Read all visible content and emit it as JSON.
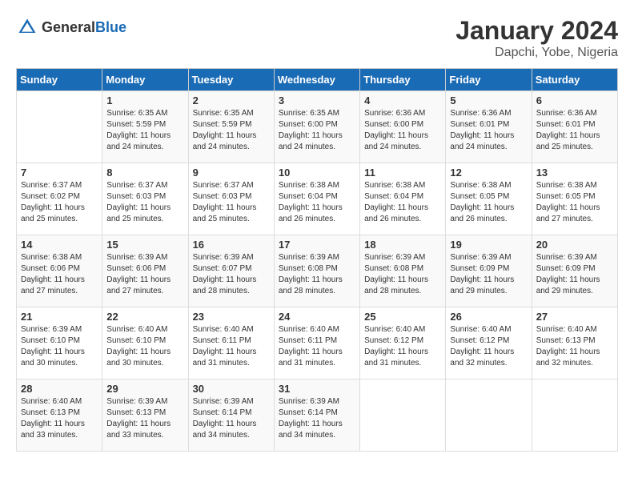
{
  "logo": {
    "general": "General",
    "blue": "Blue"
  },
  "title": "January 2024",
  "location": "Dapchi, Yobe, Nigeria",
  "headers": [
    "Sunday",
    "Monday",
    "Tuesday",
    "Wednesday",
    "Thursday",
    "Friday",
    "Saturday"
  ],
  "weeks": [
    [
      {
        "day": "",
        "sunrise": "",
        "sunset": "",
        "daylight": ""
      },
      {
        "day": "1",
        "sunrise": "Sunrise: 6:35 AM",
        "sunset": "Sunset: 5:59 PM",
        "daylight": "Daylight: 11 hours and 24 minutes."
      },
      {
        "day": "2",
        "sunrise": "Sunrise: 6:35 AM",
        "sunset": "Sunset: 5:59 PM",
        "daylight": "Daylight: 11 hours and 24 minutes."
      },
      {
        "day": "3",
        "sunrise": "Sunrise: 6:35 AM",
        "sunset": "Sunset: 6:00 PM",
        "daylight": "Daylight: 11 hours and 24 minutes."
      },
      {
        "day": "4",
        "sunrise": "Sunrise: 6:36 AM",
        "sunset": "Sunset: 6:00 PM",
        "daylight": "Daylight: 11 hours and 24 minutes."
      },
      {
        "day": "5",
        "sunrise": "Sunrise: 6:36 AM",
        "sunset": "Sunset: 6:01 PM",
        "daylight": "Daylight: 11 hours and 24 minutes."
      },
      {
        "day": "6",
        "sunrise": "Sunrise: 6:36 AM",
        "sunset": "Sunset: 6:01 PM",
        "daylight": "Daylight: 11 hours and 25 minutes."
      }
    ],
    [
      {
        "day": "7",
        "sunrise": "Sunrise: 6:37 AM",
        "sunset": "Sunset: 6:02 PM",
        "daylight": "Daylight: 11 hours and 25 minutes."
      },
      {
        "day": "8",
        "sunrise": "Sunrise: 6:37 AM",
        "sunset": "Sunset: 6:03 PM",
        "daylight": "Daylight: 11 hours and 25 minutes."
      },
      {
        "day": "9",
        "sunrise": "Sunrise: 6:37 AM",
        "sunset": "Sunset: 6:03 PM",
        "daylight": "Daylight: 11 hours and 25 minutes."
      },
      {
        "day": "10",
        "sunrise": "Sunrise: 6:38 AM",
        "sunset": "Sunset: 6:04 PM",
        "daylight": "Daylight: 11 hours and 26 minutes."
      },
      {
        "day": "11",
        "sunrise": "Sunrise: 6:38 AM",
        "sunset": "Sunset: 6:04 PM",
        "daylight": "Daylight: 11 hours and 26 minutes."
      },
      {
        "day": "12",
        "sunrise": "Sunrise: 6:38 AM",
        "sunset": "Sunset: 6:05 PM",
        "daylight": "Daylight: 11 hours and 26 minutes."
      },
      {
        "day": "13",
        "sunrise": "Sunrise: 6:38 AM",
        "sunset": "Sunset: 6:05 PM",
        "daylight": "Daylight: 11 hours and 27 minutes."
      }
    ],
    [
      {
        "day": "14",
        "sunrise": "Sunrise: 6:38 AM",
        "sunset": "Sunset: 6:06 PM",
        "daylight": "Daylight: 11 hours and 27 minutes."
      },
      {
        "day": "15",
        "sunrise": "Sunrise: 6:39 AM",
        "sunset": "Sunset: 6:06 PM",
        "daylight": "Daylight: 11 hours and 27 minutes."
      },
      {
        "day": "16",
        "sunrise": "Sunrise: 6:39 AM",
        "sunset": "Sunset: 6:07 PM",
        "daylight": "Daylight: 11 hours and 28 minutes."
      },
      {
        "day": "17",
        "sunrise": "Sunrise: 6:39 AM",
        "sunset": "Sunset: 6:08 PM",
        "daylight": "Daylight: 11 hours and 28 minutes."
      },
      {
        "day": "18",
        "sunrise": "Sunrise: 6:39 AM",
        "sunset": "Sunset: 6:08 PM",
        "daylight": "Daylight: 11 hours and 28 minutes."
      },
      {
        "day": "19",
        "sunrise": "Sunrise: 6:39 AM",
        "sunset": "Sunset: 6:09 PM",
        "daylight": "Daylight: 11 hours and 29 minutes."
      },
      {
        "day": "20",
        "sunrise": "Sunrise: 6:39 AM",
        "sunset": "Sunset: 6:09 PM",
        "daylight": "Daylight: 11 hours and 29 minutes."
      }
    ],
    [
      {
        "day": "21",
        "sunrise": "Sunrise: 6:39 AM",
        "sunset": "Sunset: 6:10 PM",
        "daylight": "Daylight: 11 hours and 30 minutes."
      },
      {
        "day": "22",
        "sunrise": "Sunrise: 6:40 AM",
        "sunset": "Sunset: 6:10 PM",
        "daylight": "Daylight: 11 hours and 30 minutes."
      },
      {
        "day": "23",
        "sunrise": "Sunrise: 6:40 AM",
        "sunset": "Sunset: 6:11 PM",
        "daylight": "Daylight: 11 hours and 31 minutes."
      },
      {
        "day": "24",
        "sunrise": "Sunrise: 6:40 AM",
        "sunset": "Sunset: 6:11 PM",
        "daylight": "Daylight: 11 hours and 31 minutes."
      },
      {
        "day": "25",
        "sunrise": "Sunrise: 6:40 AM",
        "sunset": "Sunset: 6:12 PM",
        "daylight": "Daylight: 11 hours and 31 minutes."
      },
      {
        "day": "26",
        "sunrise": "Sunrise: 6:40 AM",
        "sunset": "Sunset: 6:12 PM",
        "daylight": "Daylight: 11 hours and 32 minutes."
      },
      {
        "day": "27",
        "sunrise": "Sunrise: 6:40 AM",
        "sunset": "Sunset: 6:13 PM",
        "daylight": "Daylight: 11 hours and 32 minutes."
      }
    ],
    [
      {
        "day": "28",
        "sunrise": "Sunrise: 6:40 AM",
        "sunset": "Sunset: 6:13 PM",
        "daylight": "Daylight: 11 hours and 33 minutes."
      },
      {
        "day": "29",
        "sunrise": "Sunrise: 6:39 AM",
        "sunset": "Sunset: 6:13 PM",
        "daylight": "Daylight: 11 hours and 33 minutes."
      },
      {
        "day": "30",
        "sunrise": "Sunrise: 6:39 AM",
        "sunset": "Sunset: 6:14 PM",
        "daylight": "Daylight: 11 hours and 34 minutes."
      },
      {
        "day": "31",
        "sunrise": "Sunrise: 6:39 AM",
        "sunset": "Sunset: 6:14 PM",
        "daylight": "Daylight: 11 hours and 34 minutes."
      },
      {
        "day": "",
        "sunrise": "",
        "sunset": "",
        "daylight": ""
      },
      {
        "day": "",
        "sunrise": "",
        "sunset": "",
        "daylight": ""
      },
      {
        "day": "",
        "sunrise": "",
        "sunset": "",
        "daylight": ""
      }
    ]
  ]
}
